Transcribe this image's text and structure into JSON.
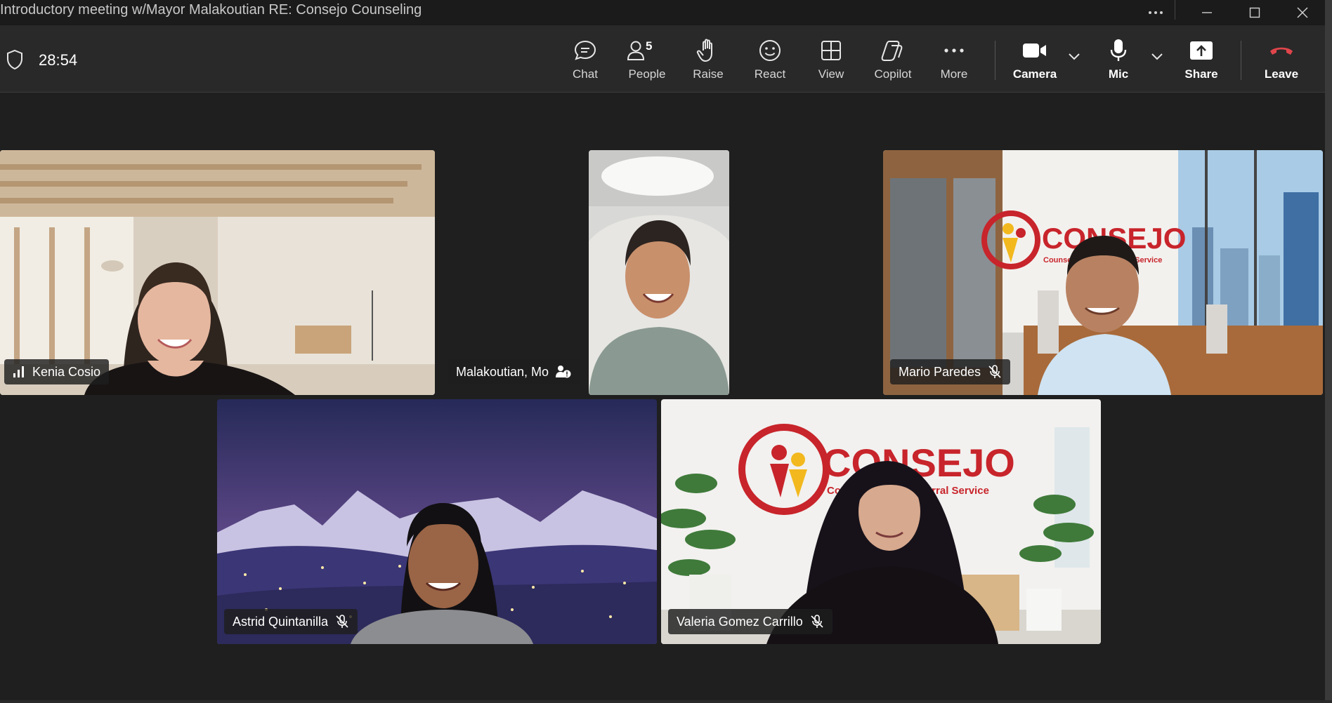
{
  "window": {
    "title": "Introductory meeting w/Mayor Malakoutian RE: Consejo Counseling"
  },
  "meeting": {
    "timer": "28:54"
  },
  "toolbar": {
    "chat": "Chat",
    "people": "People",
    "people_count": "5",
    "raise": "Raise",
    "react": "React",
    "view": "View",
    "copilot": "Copilot",
    "more": "More",
    "camera": "Camera",
    "mic": "Mic",
    "share": "Share",
    "leave": "Leave"
  },
  "participants": [
    {
      "name": "Kenia Cosio",
      "status_icon": "signal-icon"
    },
    {
      "name": "Malakoutian, Mo",
      "status_icon": "unverified-user-icon"
    },
    {
      "name": "Mario Paredes",
      "status_icon": "mic-off-icon"
    },
    {
      "name": "Astrid Quintanilla",
      "status_icon": "mic-off-icon"
    },
    {
      "name": "Valeria Gomez Carrillo",
      "status_icon": "mic-off-icon"
    }
  ],
  "backgrounds": {
    "brand_name": "CONSEJO",
    "brand_tagline_mario": "Counseling and Referral Service",
    "brand_tagline_valeria": "Counseling and Referral Service"
  },
  "colors": {
    "leave": "#e0454b",
    "brand_red": "#c8242b",
    "brand_yellow": "#f2b81e"
  }
}
